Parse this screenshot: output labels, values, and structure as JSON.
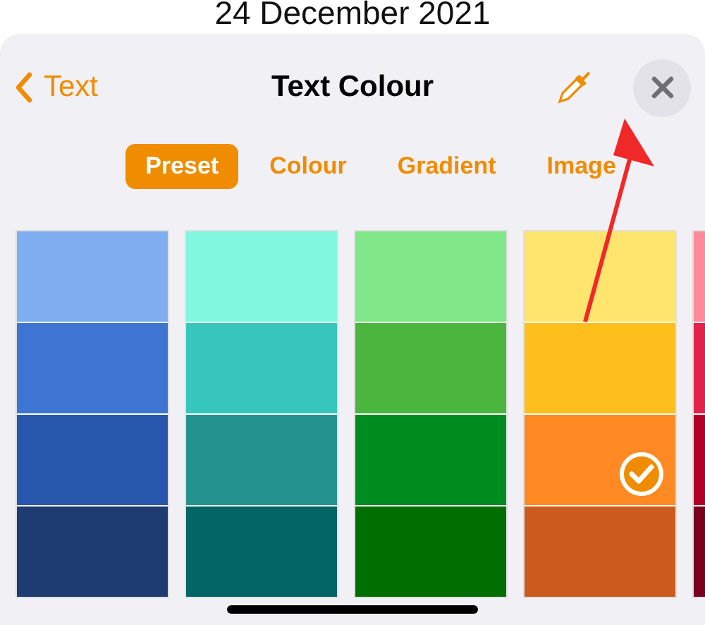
{
  "date": "24 December 2021",
  "header": {
    "back": "Text",
    "title": "Text Colour"
  },
  "tabs": [
    {
      "label": "Preset",
      "selected": true
    },
    {
      "label": "Colour",
      "selected": false
    },
    {
      "label": "Gradient",
      "selected": false
    },
    {
      "label": "Image",
      "selected": false
    }
  ],
  "palette": [
    {
      "swatches": [
        {
          "color": "#7eaef0",
          "selected": false
        },
        {
          "color": "#3e74d2",
          "selected": false
        },
        {
          "color": "#2757ad",
          "selected": false
        },
        {
          "color": "#1e3c72",
          "selected": false
        }
      ]
    },
    {
      "swatches": [
        {
          "color": "#82f7df",
          "selected": false
        },
        {
          "color": "#36c6bb",
          "selected": false
        },
        {
          "color": "#249390",
          "selected": false
        },
        {
          "color": "#026565",
          "selected": false
        }
      ]
    },
    {
      "swatches": [
        {
          "color": "#80e888",
          "selected": false
        },
        {
          "color": "#4ab63e",
          "selected": false
        },
        {
          "color": "#008c1e",
          "selected": false
        },
        {
          "color": "#006e00",
          "selected": false
        }
      ]
    },
    {
      "swatches": [
        {
          "color": "#ffe46d",
          "selected": false
        },
        {
          "color": "#febe1b",
          "selected": false
        },
        {
          "color": "#ff8a24",
          "selected": true
        },
        {
          "color": "#cc5a1c",
          "selected": false
        }
      ]
    },
    {
      "swatches": [
        {
          "color": "#ff8a9a"
        },
        {
          "color": "#e0234a"
        },
        {
          "color": "#b0002a"
        },
        {
          "color": "#7a0020"
        }
      ]
    }
  ]
}
